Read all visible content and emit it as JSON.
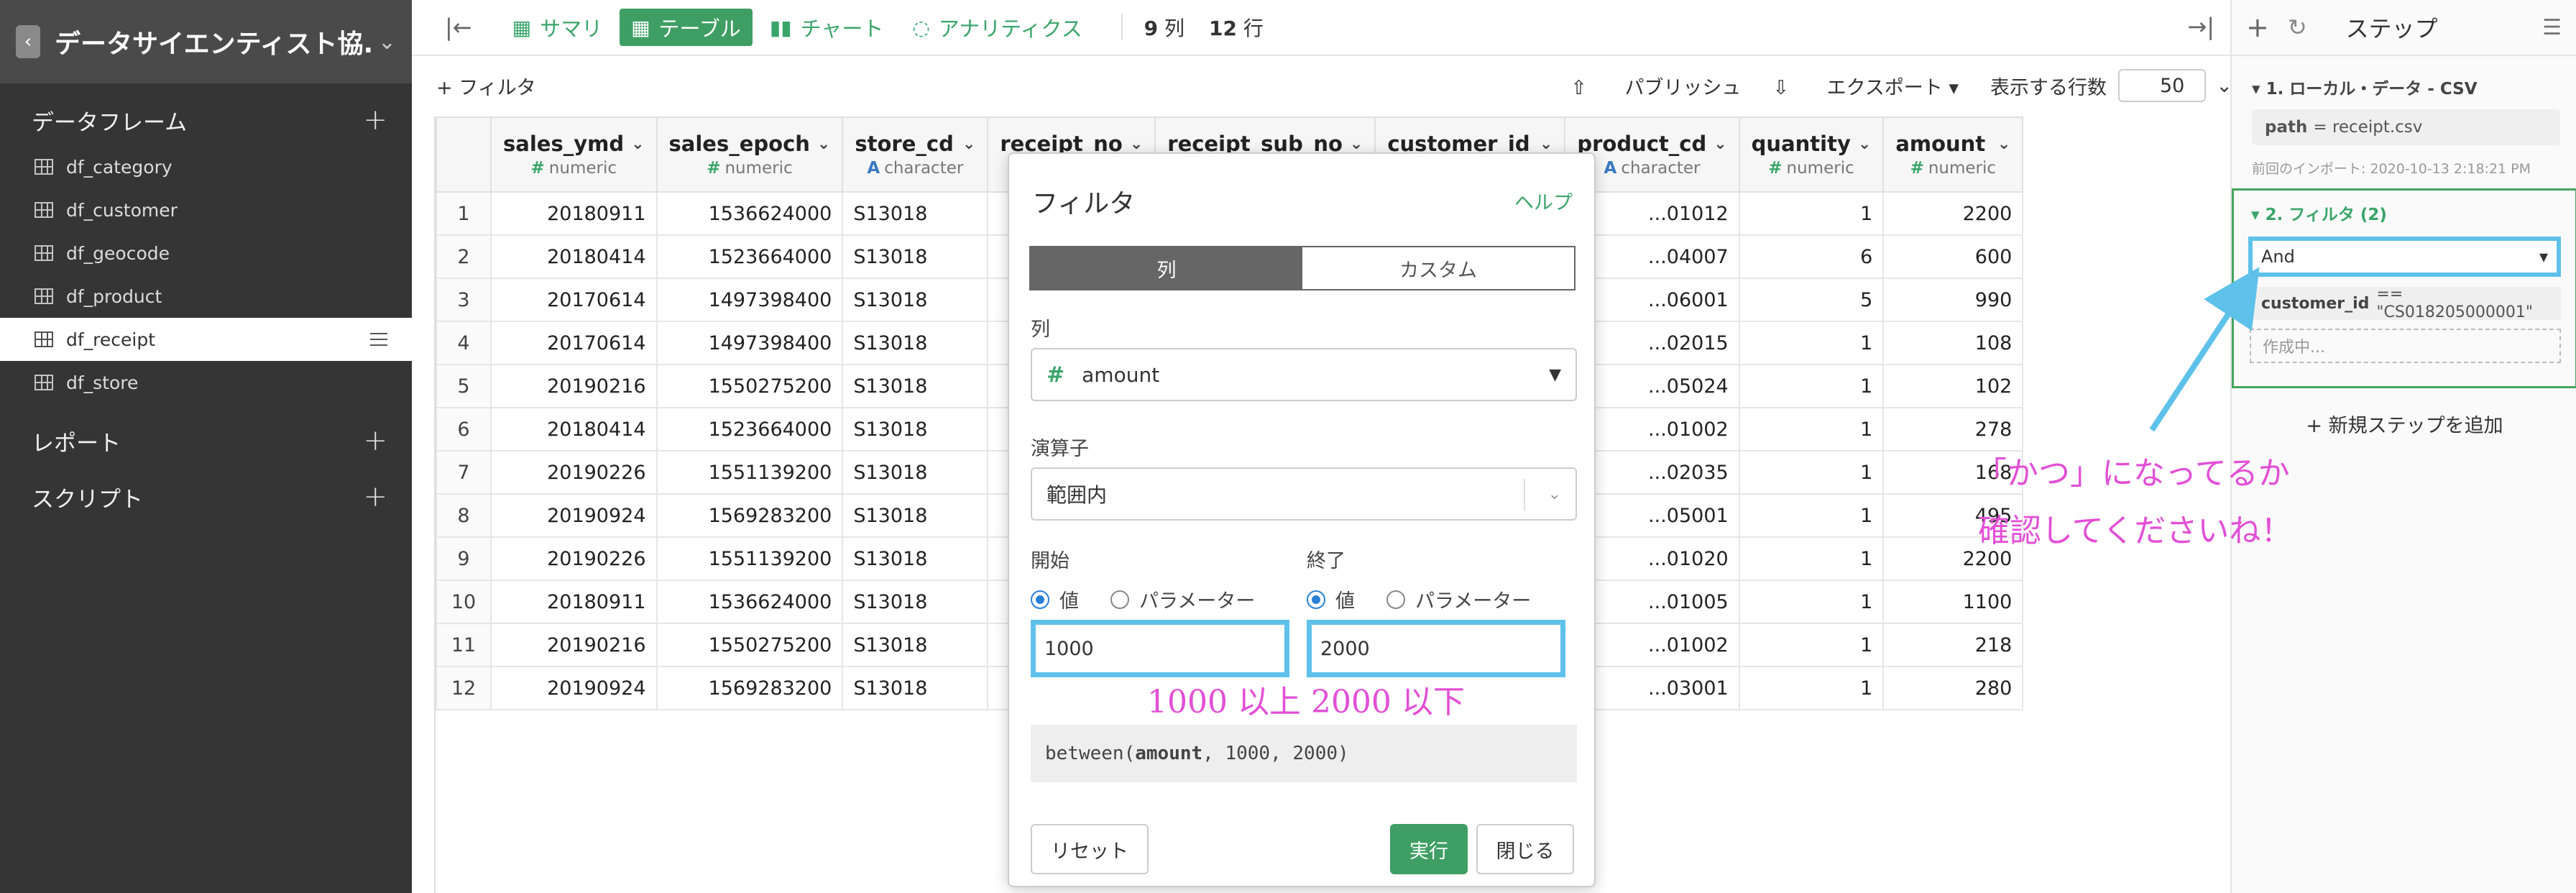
{
  "sidebar": {
    "project_title": "データサイエンティスト協...",
    "sections": [
      {
        "label": "データフレーム"
      },
      {
        "label": "レポート"
      },
      {
        "label": "スクリプト"
      }
    ],
    "dataframes": [
      {
        "label": "df_category"
      },
      {
        "label": "df_customer"
      },
      {
        "label": "df_geocode"
      },
      {
        "label": "df_product"
      },
      {
        "label": "df_receipt"
      },
      {
        "label": "df_store"
      }
    ],
    "active_dataframe": "df_receipt"
  },
  "toolbar": {
    "summary": "サマリ",
    "table": "テーブル",
    "chart": "チャート",
    "analytics": "アナリティクス",
    "col_count": "9",
    "col_unit": "列",
    "row_count": "12",
    "row_unit": "行"
  },
  "subbar": {
    "filter": "+ フィルタ",
    "publish": "パブリッシュ",
    "export": "エクスポート",
    "rows_label": "表示する行数",
    "rows_value": "50"
  },
  "table": {
    "columns": [
      {
        "name": "sales_ymd",
        "type": "numeric"
      },
      {
        "name": "sales_epoch",
        "type": "numeric"
      },
      {
        "name": "store_cd",
        "type": "character"
      },
      {
        "name": "receipt_no",
        "type": "numeric"
      },
      {
        "name": "receipt_sub_no",
        "type": "numeric"
      },
      {
        "name": "customer_id",
        "type": "character"
      },
      {
        "name": "product_cd",
        "type": "character"
      },
      {
        "name": "quantity",
        "type": "numeric"
      },
      {
        "name": "amount",
        "type": "numeric"
      }
    ],
    "rows": [
      {
        "i": "1",
        "ymd": "20180911",
        "epoch": "1536624000",
        "store": "S13018",
        "pcd": "...01012",
        "qty": "1",
        "amt": "2200"
      },
      {
        "i": "2",
        "ymd": "20180414",
        "epoch": "1523664000",
        "store": "S13018",
        "pcd": "...04007",
        "qty": "6",
        "amt": "600"
      },
      {
        "i": "3",
        "ymd": "20170614",
        "epoch": "1497398400",
        "store": "S13018",
        "pcd": "...06001",
        "qty": "5",
        "amt": "990"
      },
      {
        "i": "4",
        "ymd": "20170614",
        "epoch": "1497398400",
        "store": "S13018",
        "pcd": "...02015",
        "qty": "1",
        "amt": "108"
      },
      {
        "i": "5",
        "ymd": "20190216",
        "epoch": "1550275200",
        "store": "S13018",
        "pcd": "...05024",
        "qty": "1",
        "amt": "102"
      },
      {
        "i": "6",
        "ymd": "20180414",
        "epoch": "1523664000",
        "store": "S13018",
        "pcd": "...01002",
        "qty": "1",
        "amt": "278"
      },
      {
        "i": "7",
        "ymd": "20190226",
        "epoch": "1551139200",
        "store": "S13018",
        "pcd": "...02035",
        "qty": "1",
        "amt": "168"
      },
      {
        "i": "8",
        "ymd": "20190924",
        "epoch": "1569283200",
        "store": "S13018",
        "pcd": "...05001",
        "qty": "1",
        "amt": "495"
      },
      {
        "i": "9",
        "ymd": "20190226",
        "epoch": "1551139200",
        "store": "S13018",
        "pcd": "...01020",
        "qty": "1",
        "amt": "2200"
      },
      {
        "i": "10",
        "ymd": "20180911",
        "epoch": "1536624000",
        "store": "S13018",
        "pcd": "...01005",
        "qty": "1",
        "amt": "1100"
      },
      {
        "i": "11",
        "ymd": "20190216",
        "epoch": "1550275200",
        "store": "S13018",
        "pcd": "...01002",
        "qty": "1",
        "amt": "218"
      },
      {
        "i": "12",
        "ymd": "20190924",
        "epoch": "1569283200",
        "store": "S13018",
        "pcd": "...03001",
        "qty": "1",
        "amt": "280"
      }
    ]
  },
  "modal": {
    "title": "フィルタ",
    "help": "ヘルプ",
    "tab_column": "列",
    "tab_custom": "カスタム",
    "column_label": "列",
    "column_value": "amount",
    "operator_label": "演算子",
    "operator_value": "範囲内",
    "start_label": "開始",
    "end_label": "終了",
    "radio_value": "値",
    "radio_param": "パラメーター",
    "start_value": "1000",
    "end_value": "2000",
    "code_prefix": "between(",
    "code_col": "amount",
    "code_suffix": ", 1000, 2000)",
    "reset": "リセット",
    "run": "実行",
    "close": "閉じる"
  },
  "steps": {
    "title": "ステップ",
    "step1_title": "1. ローカル・データ - CSV",
    "step1_path_key": "path",
    "step1_path_value": "= receipt.csv",
    "step1_note": "前回のインポート: 2020-10-13 2:18:21 PM",
    "step2_title": "2. フィルタ (2)",
    "and_value": "And",
    "cond_col": "customer_id",
    "cond_expr": "== \"CS018205000001\"",
    "creating": "作成中...",
    "add_step": "新規ステップを追加"
  },
  "annotations": {
    "range_note": "1000 以上 2000 以下",
    "and_note_line1": "「かつ」になってるか",
    "and_note_line2": "確認してくださいね！"
  },
  "colors": {
    "accent": "#3f9e63",
    "highlight": "#5ec1ea",
    "annotation": "#e24fd6"
  }
}
